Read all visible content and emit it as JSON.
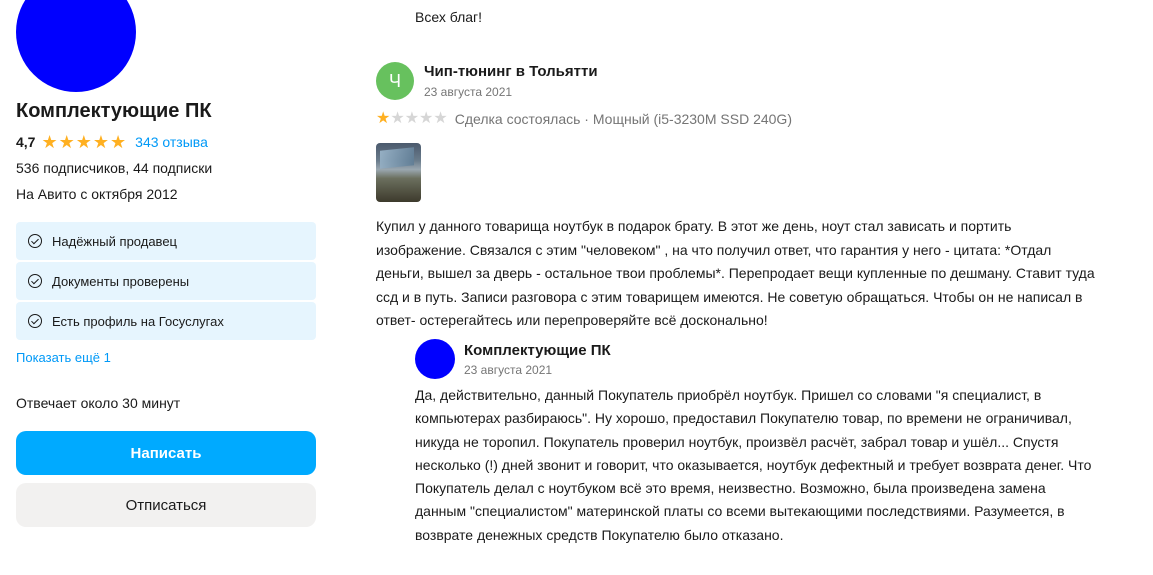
{
  "seller": {
    "name": "Комплектующие ПК",
    "rating": "4,7",
    "stars_filled": 5,
    "reviews_link": "343 отзыва",
    "subscribers": "536 подписчиков, 44 подписки",
    "since": "На Авито с октября 2012",
    "badges": [
      {
        "label": "Надёжный продавец"
      },
      {
        "label": "Документы проверены"
      },
      {
        "label": "Есть профиль на Госуслугах"
      }
    ],
    "show_more": "Показать ещё 1",
    "response_time": "Отвечает около 30 минут",
    "write_button": "Написать",
    "unsubscribe_button": "Отписаться"
  },
  "previous_tail": "Всех благ!",
  "review": {
    "avatar_letter": "Ч",
    "author": "Чип-тюнинг в Тольятти",
    "date": "23 августа 2021",
    "rating": 1,
    "meta": "Сделка состоялась · Мощный (i5-3230M SSD 240G)",
    "text": "Купил у данного товарища ноутбук в подарок брату. В этот же день, ноут стал зависать и портить изображение. Связался с этим \"человеком\" , на что получил ответ, что гарантия у него - цитата: *Отдал деньги, вышел за дверь - остальное твои проблемы*. Перепродает вещи купленные по дешману. Ставит туда ссд и в путь. Записи разговора с этим товарищем имеются. Не советую обращаться. Чтобы он не написал в ответ- остерегайтесь или перепроверяйте всё досконально!",
    "reply": {
      "author": "Комплектующие ПК",
      "date": "23 августа 2021",
      "text": "Да, действительно, данный Покупатель приобрёл ноутбук. Пришел со словами \"я специалист, в компьютерах разбираюсь\". Ну хорошо, предоставил Покупателю товар, по времени не ограничивал, никуда не торопил. Покупатель проверил ноутбук, произвёл расчёт, забрал товар и ушёл... Спустя несколько (!) дней звонит и говорит, что оказывается, ноутбук дефектный и требует возврата денег. Что Покупатель делал с ноутбуком всё это время, неизвестно. Возможно, была произведена замена данным \"специалистом\" материнской платы со всеми вытекающими последствиями. Разумеется, в возврате денежных средств Покупателю было отказано."
    }
  },
  "colors": {
    "accent": "#00aaff",
    "link": "#0099f7",
    "star": "#ffb021",
    "badge_bg": "#e6f5fe",
    "avatar_blue": "#0000ff",
    "avatar_green": "#67c15e"
  }
}
